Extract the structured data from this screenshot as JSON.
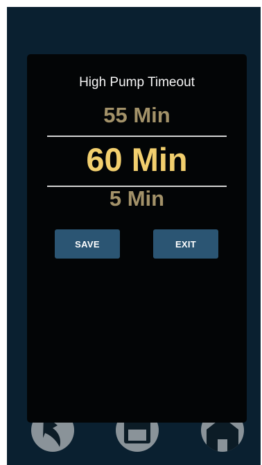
{
  "dialog": {
    "title": "High Pump Timeout",
    "picker": {
      "previous": "55 Min",
      "selected": "60 Min",
      "next": "5 Min"
    },
    "buttons": {
      "save_label": "SAVE",
      "exit_label": "EXIT"
    }
  },
  "bottom_nav": [
    {
      "icon": "back-arrow-icon"
    },
    {
      "icon": "save-disk-icon"
    },
    {
      "icon": "home-icon"
    }
  ],
  "colors": {
    "background": "#0a2030",
    "dialog": "#030506",
    "selected_value": "#f2cf6e",
    "adjacent_value": "#a39269",
    "button": "#2b5573",
    "nav_button": "#8a9399"
  }
}
